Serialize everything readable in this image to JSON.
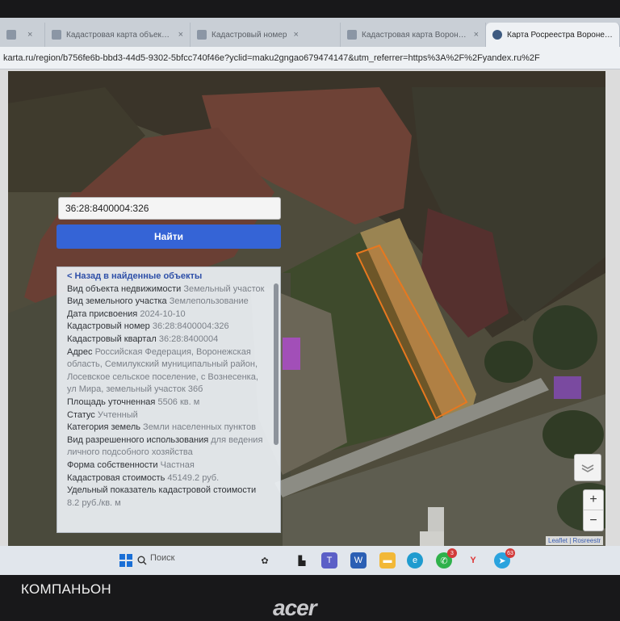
{
  "overlay_label": "КОМПАНЬОН",
  "laptop_brand": "acer",
  "browser": {
    "tabs": [
      {
        "label": "",
        "active": false
      },
      {
        "label": "Кадастровая карта объекта данных",
        "active": false
      },
      {
        "label": "Кадастровый номер",
        "active": false
      },
      {
        "label": "Кадастровая карта Воронежской",
        "active": false
      },
      {
        "label": "Карта Росреестра Воронежско",
        "active": true
      }
    ],
    "url": "karta.ru/region/b756fe6b-bbd3-44d5-9302-5bfcc740f46e?yclid=maku2gngao679474147&utm_referrer=https%3A%2F%2Fyandex.ru%2F"
  },
  "search": {
    "value": "36:28:8400004:326",
    "button_label": "Найти"
  },
  "info_panel": {
    "back_link": "< Назад в найденные объекты",
    "rows": [
      {
        "key": "Вид объекта недвижимости",
        "value": "Земельный участок"
      },
      {
        "key": "Вид земельного участка",
        "value": "Землепользование"
      },
      {
        "key": "Дата присвоения",
        "value": "2024-10-10"
      },
      {
        "key": "Кадастровый номер",
        "value": "36:28:8400004:326"
      },
      {
        "key": "Кадастровый квартал",
        "value": "36:28:8400004"
      },
      {
        "key": "Адрес",
        "value": "Российская Федерация, Воронежская область, Семилукский муниципальный район, Лосевское сельское поселение, с Вознесенка, ул Мира, земельный участок 36б"
      },
      {
        "key": "Площадь уточненная",
        "value": "5506 кв. м"
      },
      {
        "key": "Статус",
        "value": "Учтенный"
      },
      {
        "key": "Категория земель",
        "value": "Земли населенных пунктов"
      },
      {
        "key": "Вид разрешенного использования",
        "value": "для ведения личного подсобного хозяйства"
      },
      {
        "key": "Форма собственности",
        "value": "Частная"
      },
      {
        "key": "Кадастровая стоимость",
        "value": "45149.2 руб."
      },
      {
        "key": "Удельный показатель кадастровой стоимости",
        "value": "8.2 руб./кв. м"
      }
    ]
  },
  "map": {
    "zoom_in": "+",
    "zoom_out": "−",
    "attribution": "Leaflet | Rosreestr",
    "parcel_color": "#e8781f"
  },
  "taskbar": {
    "search_label": "Поиск",
    "telegram_badge": "63",
    "whatsapp_badge": "3"
  }
}
